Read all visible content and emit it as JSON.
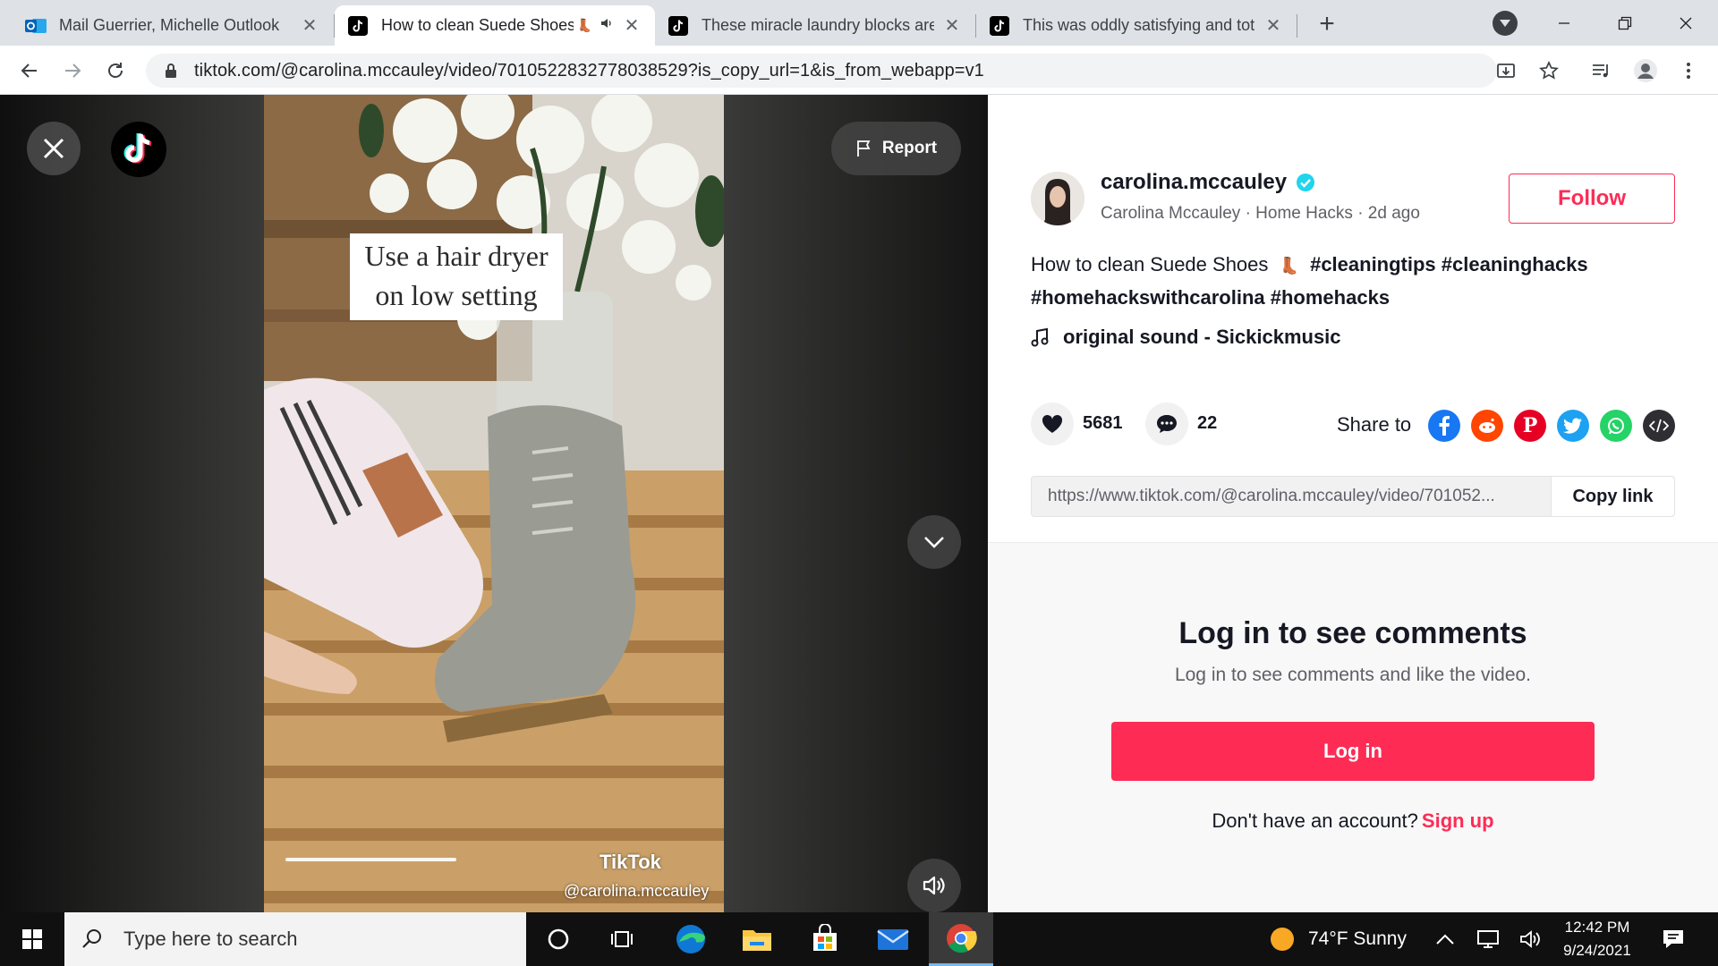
{
  "tabs": [
    {
      "label": "Mail   Guerrier, Michelle   Outlook",
      "favicon": "outlook-icon",
      "active": false
    },
    {
      "label": "How to clean Suede Shoes",
      "favicon": "tiktok-icon",
      "active": true,
      "extra_icons": [
        "boot-emoji",
        "speaker-icon"
      ]
    },
    {
      "label": "These miracle laundry blocks are",
      "favicon": "tiktok-icon",
      "active": false
    },
    {
      "label": "This was oddly satisfying and tot",
      "favicon": "tiktok-icon",
      "active": false
    }
  ],
  "address_bar": {
    "url": "tiktok.com/@carolina.mccauley/video/7010522832778038529?is_copy_url=1&is_from_webapp=v1"
  },
  "video": {
    "report_label": "Report",
    "caption_line1": "Use a hair dryer",
    "caption_line2": "on low setting",
    "watermark": "TikTok",
    "watermark_handle": "@carolina.mccauley",
    "progress_fraction": 0.39
  },
  "author": {
    "username": "carolina.mccauley",
    "verified": true,
    "display_line": "Carolina Mccauley · Home Hacks · 2d ago",
    "follow_label": "Follow"
  },
  "description": {
    "text": "How to clean Suede Shoes",
    "hashtags_line1": "#cleaningtips #cleaninghacks",
    "hashtags_line2": "#homehackswithcarolina #homehacks"
  },
  "sound": {
    "label": "original sound - Sickickmusic"
  },
  "stats": {
    "likes": "5681",
    "comments": "22"
  },
  "share": {
    "label": "Share to",
    "targets": [
      "facebook-icon",
      "reddit-icon",
      "pinterest-icon",
      "twitter-icon",
      "whatsapp-icon",
      "embed-icon"
    ]
  },
  "link": {
    "url": "https://www.tiktok.com/@carolina.mccauley/video/701052...",
    "copy_label": "Copy link"
  },
  "comments": {
    "title": "Log in to see comments",
    "subtitle": "Log in to see comments and like the video.",
    "login_label": "Log in",
    "no_account": "Don't have an account?",
    "signup_label": "Sign up"
  },
  "taskbar": {
    "search_placeholder": "Type here to search",
    "weather": "74°F  Sunny",
    "time": "12:42 PM",
    "date": "9/24/2021"
  },
  "colors": {
    "tiktok_red": "#fe2c55",
    "verified_blue": "#20d5ec"
  }
}
